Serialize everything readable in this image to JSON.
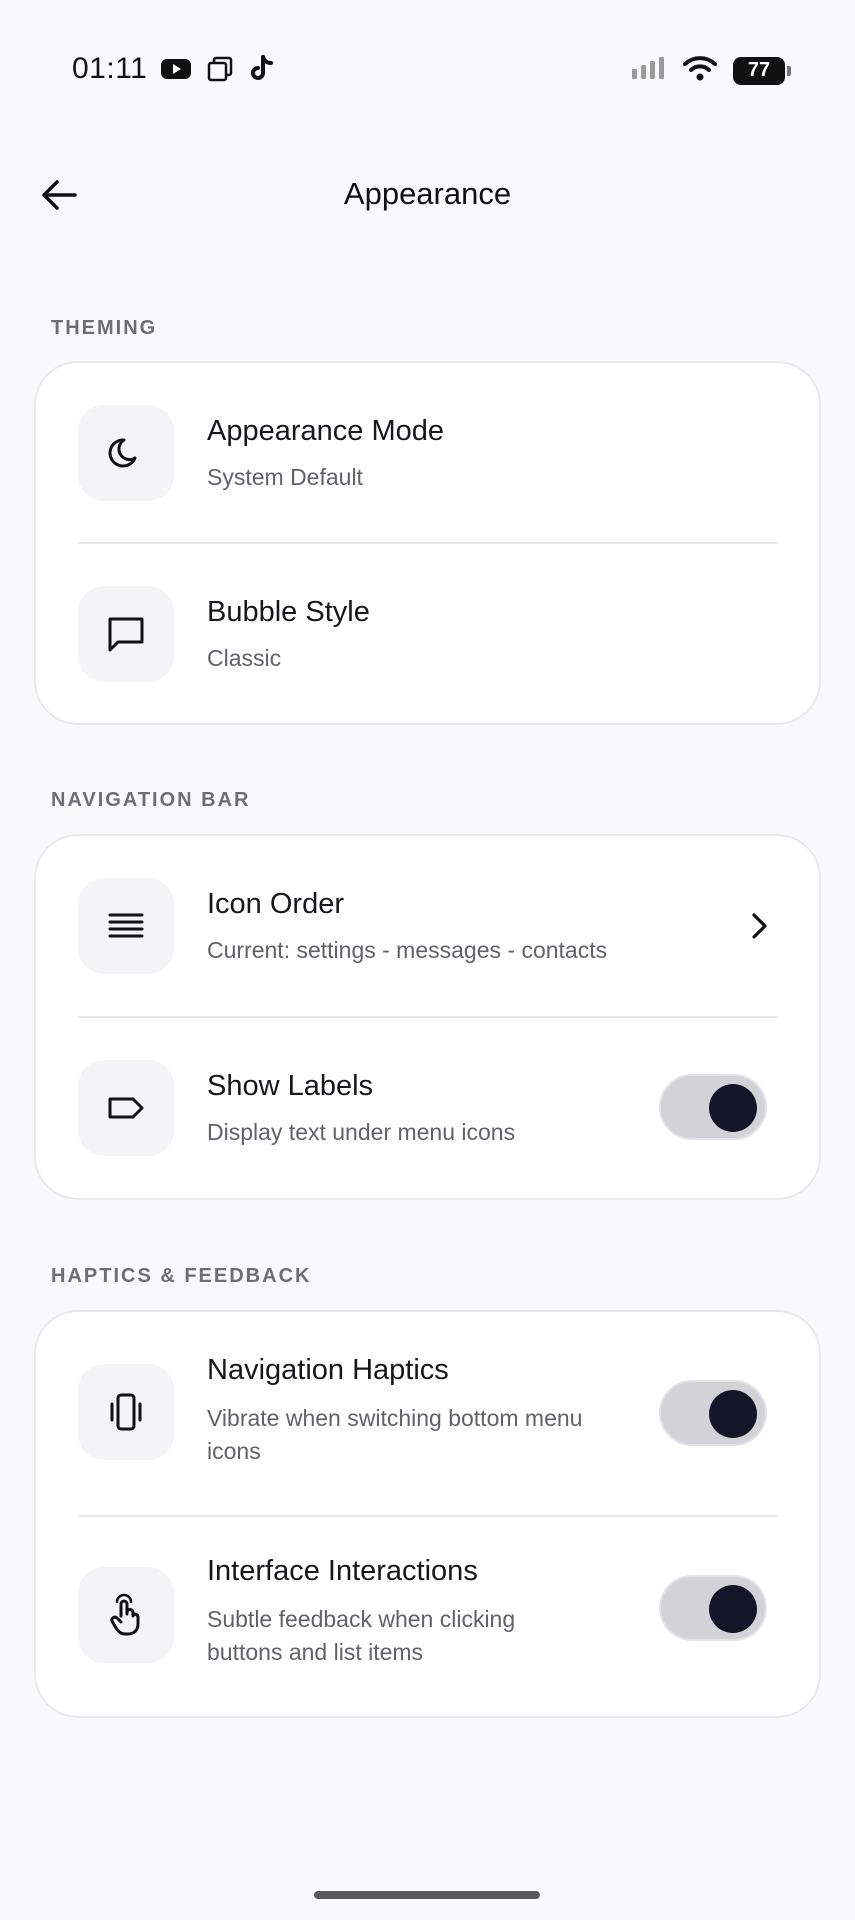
{
  "status_bar": {
    "time": "01:11",
    "battery": "77",
    "icons": [
      "youtube-icon",
      "copy-icon",
      "tiktok-icon",
      "signal-icon",
      "wifi-icon",
      "battery-icon"
    ]
  },
  "header": {
    "title": "Appearance",
    "back_icon": "arrow-left-icon"
  },
  "sections": {
    "theming": {
      "label": "THEMING",
      "appearance_mode": {
        "title": "Appearance Mode",
        "subtitle": "System Default",
        "icon": "moon-icon"
      },
      "bubble_style": {
        "title": "Bubble Style",
        "subtitle": "Classic",
        "icon": "chat-bubble-icon"
      }
    },
    "navigation_bar": {
      "label": "NAVIGATION BAR",
      "icon_order": {
        "title": "Icon Order",
        "subtitle": "Current: settings - messages - contacts",
        "icon": "list-icon"
      },
      "show_labels": {
        "title": "Show Labels",
        "subtitle": "Display text under menu icons",
        "icon": "tag-icon",
        "enabled": true
      }
    },
    "haptics": {
      "label": "HAPTICS & FEEDBACK",
      "navigation_haptics": {
        "title": "Navigation Haptics",
        "subtitle_line1": "Vibrate when switching bottom menu",
        "subtitle_line2": "icons",
        "icon": "vibrate-icon",
        "enabled": true
      },
      "interface_interactions": {
        "title": "Interface Interactions",
        "subtitle_line1": "Subtle feedback when clicking",
        "subtitle_line2": "buttons and list items",
        "icon": "tap-hand-icon",
        "enabled": true
      }
    }
  },
  "colors": {
    "background": "#f8f9fb",
    "card": "#ffffff",
    "toggle_track": "#d2d3d6",
    "toggle_knob": "#121628",
    "section_label": "#6b6e75"
  }
}
